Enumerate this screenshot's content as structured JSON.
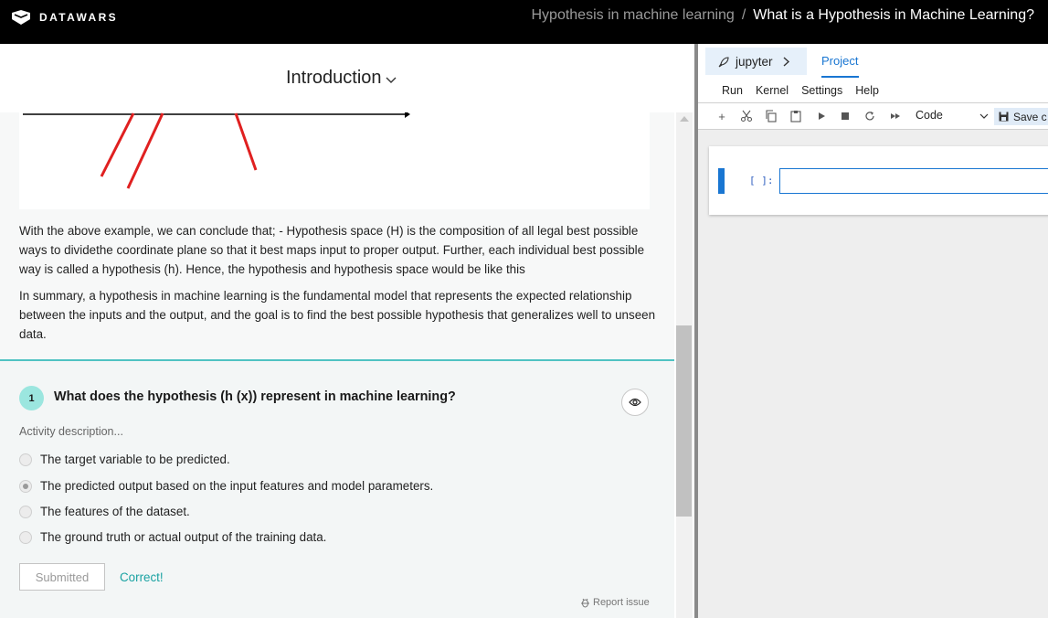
{
  "header": {
    "logo_text": "DATAWARS",
    "breadcrumb_parent": "Hypothesis in machine learning",
    "breadcrumb_separator": "/",
    "breadcrumb_current": "What is a Hypothesis in Machine Learning?"
  },
  "section": {
    "title": "Introduction"
  },
  "content": {
    "paragraph1": "With the above example, we can conclude that; - Hypothesis space (H) is the composition of all legal best possible ways to dividethe coordinate plane so that it best maps input to proper output. Further, each individual best possible way is called a hypothesis (h). Hence, the hypothesis and hypothesis space would be like this",
    "paragraph2": "In summary, a hypothesis in machine learning is the fundamental model that represents the expected relationship between the inputs and the output, and the goal is to find the best possible hypothesis that generalizes well to unseen data."
  },
  "quiz": {
    "number": "1",
    "question": "What does the hypothesis (h (x)) represent in machine learning?",
    "activity_description": "Activity description...",
    "options": [
      {
        "label": "The target variable to be predicted.",
        "selected": false
      },
      {
        "label": "The predicted output based on the input features and model parameters.",
        "selected": true
      },
      {
        "label": "The features of the dataset.",
        "selected": false
      },
      {
        "label": "The ground truth or actual output of the training data.",
        "selected": false
      }
    ],
    "submitted_label": "Submitted",
    "result_text": "Correct!",
    "report_label": "Report issue"
  },
  "jupyter": {
    "app_label": "jupyter",
    "project_tab": "Project",
    "menu": [
      "Run",
      "Kernel",
      "Settings",
      "Help"
    ],
    "cell_type": "Code",
    "save_label": "Save c",
    "cell_prompt": "[ ]:"
  },
  "colors": {
    "accent_teal": "#19a2a2",
    "divider_teal": "#4fc3c3",
    "jupyter_blue": "#1976d2",
    "figure_red": "#e02020"
  }
}
